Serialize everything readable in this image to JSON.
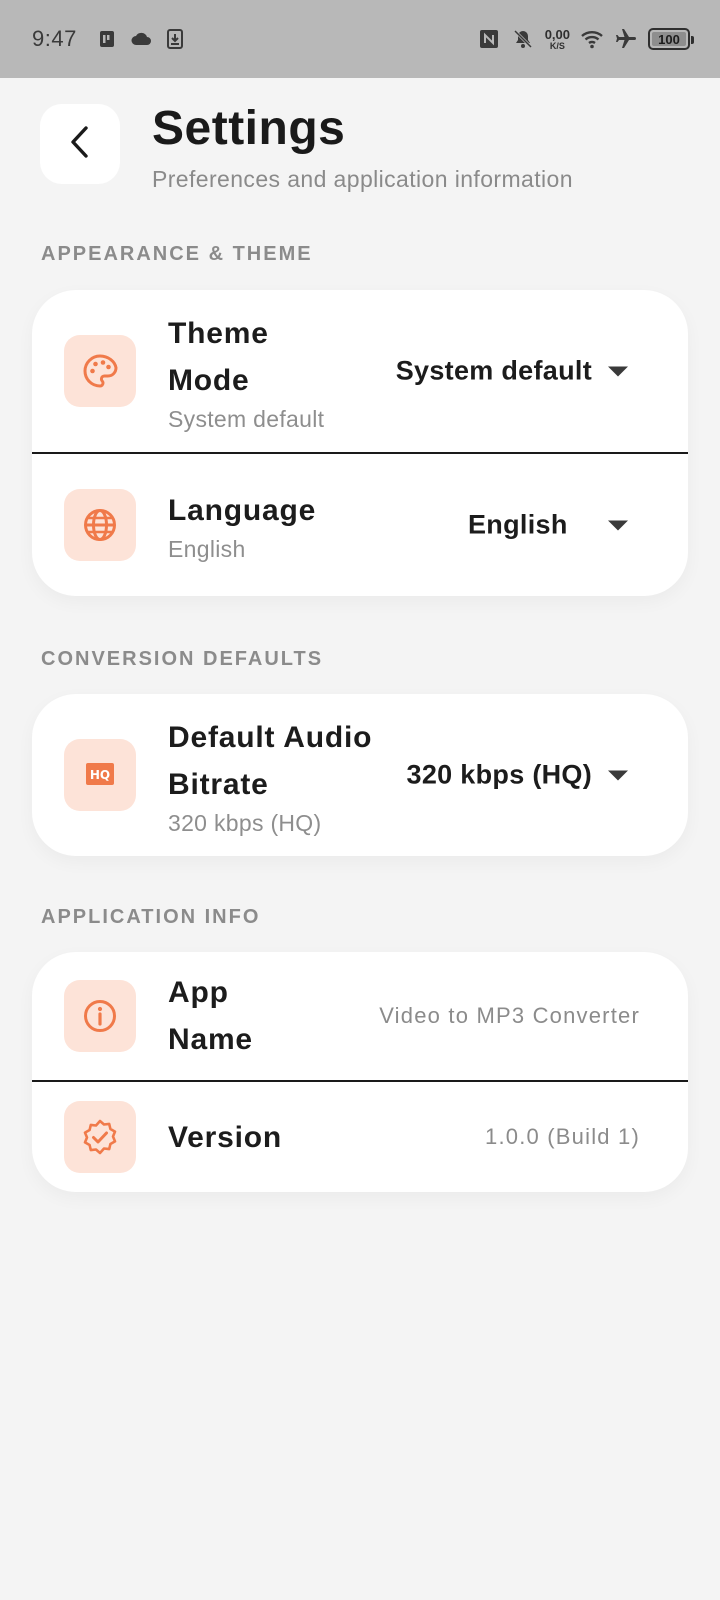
{
  "status_bar": {
    "time": "9:47",
    "left_icons": [
      "sim-card-icon",
      "cloud-icon",
      "download-icon"
    ],
    "right_icons": [
      "nfc-icon",
      "bell-off-icon",
      "wifi-icon",
      "airplane-icon"
    ],
    "speed_value": "0,00",
    "speed_unit": "K/S",
    "battery": "100"
  },
  "header": {
    "title": "Settings",
    "subtitle": "Preferences and application information"
  },
  "sections": {
    "appearance": {
      "label": "APPEARANCE & THEME",
      "theme": {
        "title_line1": "Theme",
        "title_line2": "Mode",
        "subtitle": "System default",
        "value": "System default",
        "icon": "palette-icon"
      },
      "language": {
        "title": "Language",
        "subtitle": "English",
        "value": "English",
        "icon": "globe-icon"
      }
    },
    "conversion": {
      "label": "CONVERSION DEFAULTS",
      "bitrate": {
        "title_line1": "Default Audio",
        "title_line2": "Bitrate",
        "subtitle": "320 kbps (HQ)",
        "value": "320 kbps (HQ)",
        "icon": "hq-icon",
        "icon_text": "HQ"
      }
    },
    "info": {
      "label": "APPLICATION INFO",
      "app_name": {
        "title_line1": "App",
        "title_line2": "Name",
        "value": "Video to MP3 Converter",
        "icon": "info-icon"
      },
      "version": {
        "title": "Version",
        "value": "1.0.0 (Build 1)",
        "icon": "verified-badge-icon"
      }
    }
  },
  "colors": {
    "accent": "#f07a4a",
    "icon_bg": "#fde3d8",
    "background": "#f4f4f4",
    "status_bar": "#b8b8b8"
  }
}
